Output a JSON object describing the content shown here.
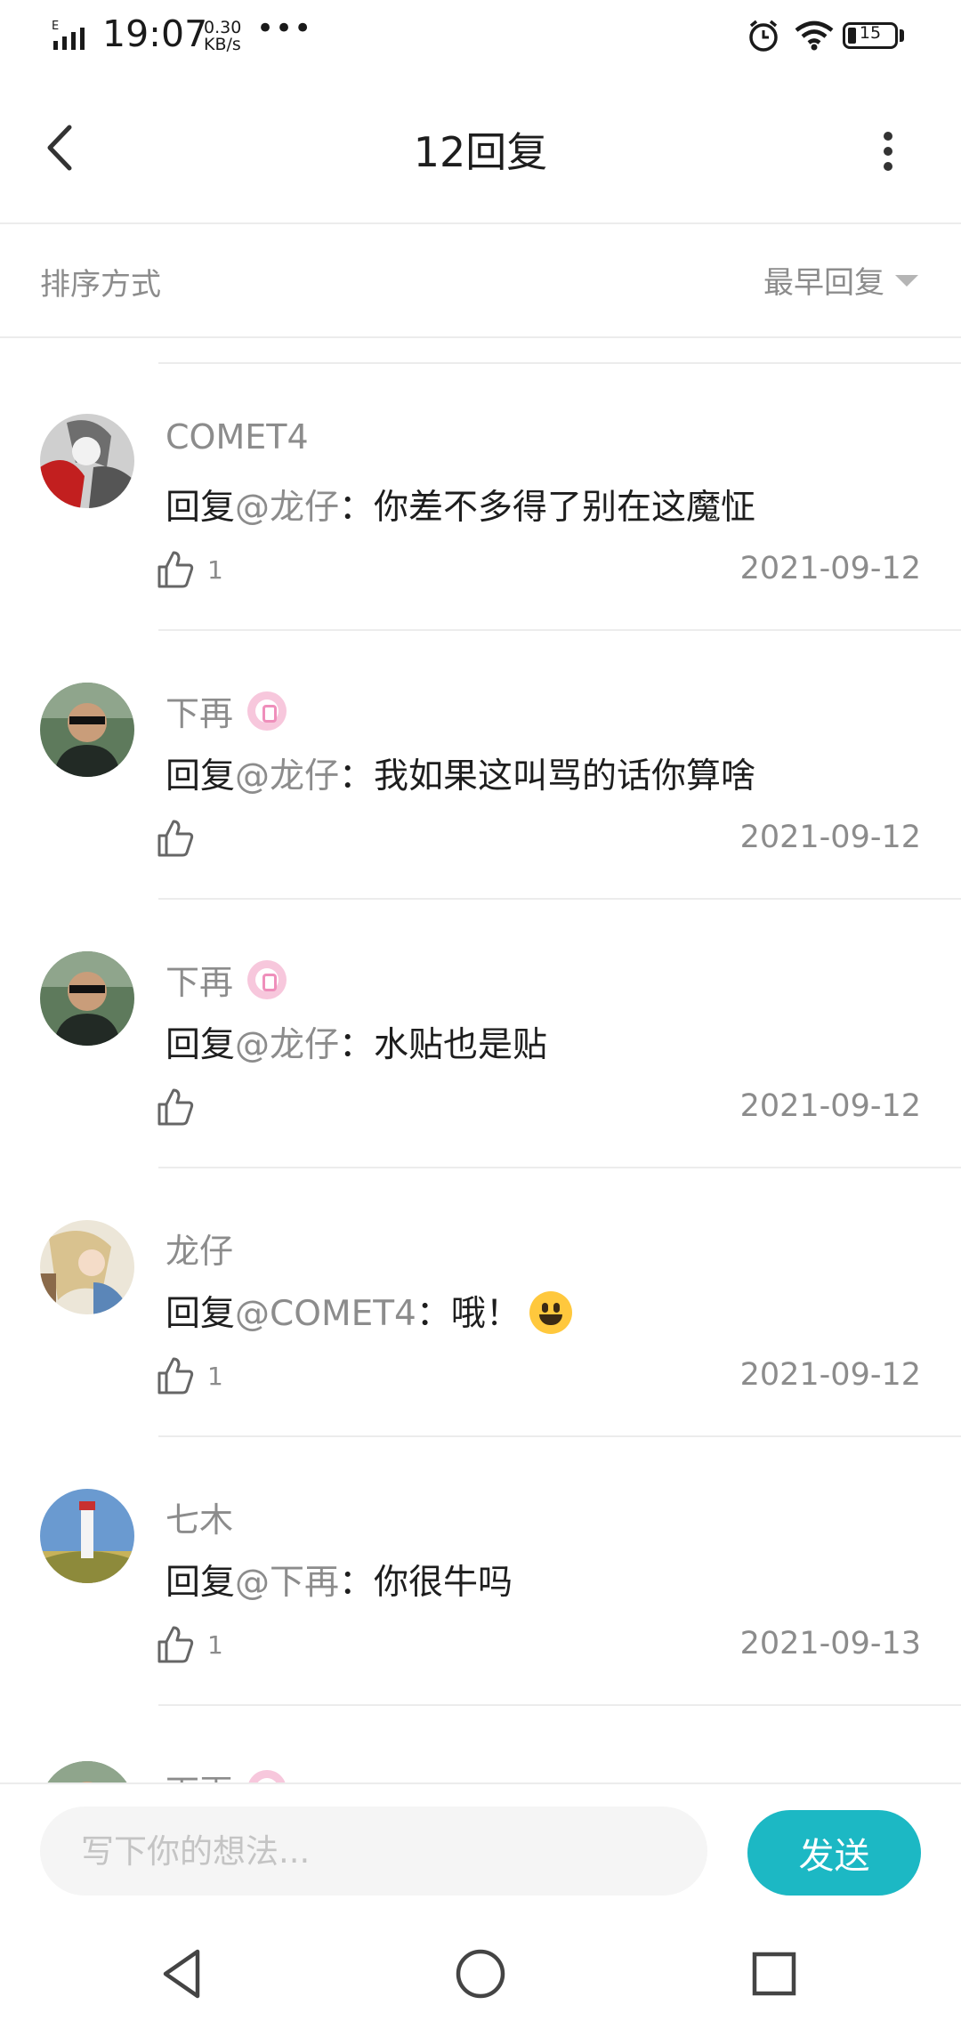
{
  "status_bar": {
    "network": "E",
    "time": "19:07",
    "speed_value": "0.30",
    "speed_unit": "KB/s",
    "more": "•••",
    "battery": "15"
  },
  "header": {
    "title": "12回复",
    "back_icon": "chevron-left-icon",
    "more_icon": "more-vertical-icon"
  },
  "sort": {
    "label": "排序方式",
    "value": "最早回复"
  },
  "comments": [
    {
      "username": "COMET4",
      "has_badge": false,
      "reply_prefix": "回复",
      "mention": "@龙仔",
      "text": "：你差不多得了别在这魔怔",
      "likes": "1",
      "date": "2021-09-12",
      "avatar_color": "#b52020"
    },
    {
      "username": "下再",
      "has_badge": true,
      "reply_prefix": "回复",
      "mention": "@龙仔",
      "text": "：我如果这叫骂的话你算啥",
      "likes": "",
      "date": "2021-09-12",
      "avatar_color": "#3f5240"
    },
    {
      "username": "下再",
      "has_badge": true,
      "reply_prefix": "回复",
      "mention": "@龙仔",
      "text": "：水贴也是贴",
      "likes": "",
      "date": "2021-09-12",
      "avatar_color": "#3f5240"
    },
    {
      "username": "龙仔",
      "has_badge": false,
      "reply_prefix": "回复",
      "mention": "@COMET4",
      "text": "：哦！",
      "likes": "1",
      "date": "2021-09-12",
      "avatar_color": "#c9b48a"
    },
    {
      "username": "七木",
      "has_badge": false,
      "reply_prefix": "回复",
      "mention": "@下再",
      "text": "：你很牛吗",
      "likes": "1",
      "date": "2021-09-13",
      "avatar_color": "#4f7fb5"
    }
  ],
  "partial_comment": {
    "username": "下再"
  },
  "input_bar": {
    "placeholder": "写下你的想法...",
    "send_label": "发送"
  },
  "colors": {
    "accent": "#1cb8c4",
    "muted_text": "#8c8c8c",
    "divider": "#ececec"
  }
}
